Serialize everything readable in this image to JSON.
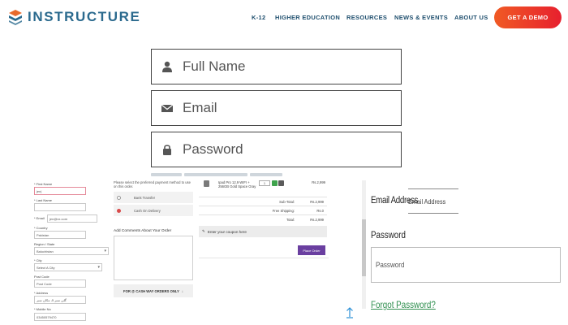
{
  "header": {
    "logo_text": "INSTRUCTURE",
    "nav": [
      "K-12",
      "HIGHER EDUCATION",
      "RESOURCES",
      "NEWS & EVENTS",
      "ABOUT US"
    ],
    "cta_label": "GET A DEMO",
    "colors": {
      "brand": "#2b6a8e",
      "cta_start": "#f05a24",
      "cta_end": "#e7202e"
    }
  },
  "login_fields": {
    "full_name": "Full Name",
    "email": "Email",
    "password": "Password"
  },
  "checkout_form": {
    "labels": [
      "* First Name",
      "* Last Name",
      "* Email",
      "* Country",
      "Region / State",
      "* City",
      "Post Code",
      "* Address",
      "* Mobile No"
    ],
    "first_name_value": "jen|",
    "email_value": "jen@xx.com",
    "country_value": "Pakistan",
    "region_value": "Baluchistan",
    "city_value": "Select A City",
    "post_code_value": "Post Code",
    "address_value": "گلی نمبر 5، مکان نمبر",
    "mobile_value": "03450579470"
  },
  "payment": {
    "note": "Please select the preferred payment method to use on this order.",
    "options": [
      "Bank Transfer",
      "Cash On Delivery"
    ],
    "comments_label": "Add Comments About Your Order",
    "cod_banner": "FOR @ CASH WAY ORDERS ONLY"
  },
  "summary": {
    "product_name": "Ipad Pro 12.9 WIFI + 256GB Gold Space Gray",
    "qty": "1",
    "product_price": "Rs.2,999",
    "rows": [
      {
        "key": "Sub-Total:",
        "value": "Rs.2,999"
      },
      {
        "key": "Free Shipping:",
        "value": "Rs.0"
      },
      {
        "key": "Total:",
        "value": "Rs.2,999"
      }
    ],
    "coupon": "Enter your coupon here",
    "place_order": "Place Order"
  },
  "right_form": {
    "email_label": "Email Address",
    "email_placeholder": "Email Address",
    "password_label": "Password",
    "password_placeholder": "Password",
    "forgot": "Forgot Password?",
    "link_color": "#2f8f4f"
  },
  "icons": [
    "user-icon",
    "envelope-icon",
    "lock-icon",
    "up-arrow-icon"
  ]
}
